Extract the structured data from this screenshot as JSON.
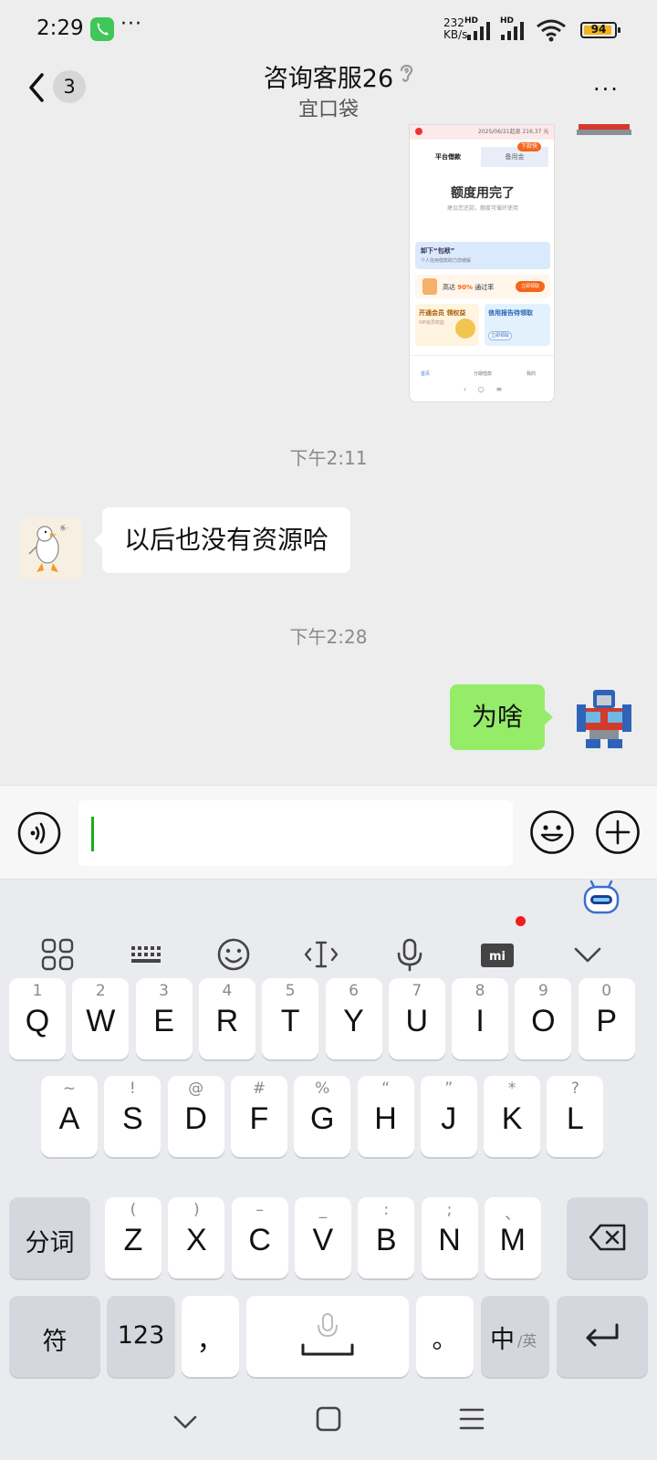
{
  "status_bar": {
    "time": "2:29",
    "dots": "···",
    "net_speed_value": "232",
    "net_speed_unit": "KB/s",
    "hd_label": "HD",
    "battery": "94",
    "icons": [
      "phone-call-icon",
      "signal-icon",
      "wifi-icon",
      "battery-icon"
    ],
    "battery_color": "#f2b31d"
  },
  "header": {
    "unread_badge": "3",
    "title": "咨询客服26",
    "subtitle": "宜口袋",
    "more_label": "···"
  },
  "shared_screenshot": {
    "status": "2025/06/21起息 216.37 元",
    "tab_left": "平台借款",
    "tab_right": "备用金",
    "tab_badge": "下款快",
    "headline": "额度用完了",
    "headline_sub": "建议您还款，额度可循环使用",
    "banner1": "卸下“包袱”",
    "banner1_sub": "个人信用借款助力您缓解",
    "banner2_label": "高达",
    "banner2_pct": "90%",
    "banner2_suffix": "通过率",
    "banner2_btn": "立即领取",
    "card_left": "开通会员 领权益",
    "card_left_sub": "VIP会员权益",
    "card_right": "信用报告待领取",
    "card_right_btn": "立即领取",
    "nav_home": "首页",
    "nav_mid": "分期借款",
    "nav_me": "我的"
  },
  "messages": [
    {
      "type": "timestamp",
      "text": "下午2:11"
    },
    {
      "type": "incoming",
      "text": "以后也没有资源哈",
      "avatar": "goose-avatar"
    },
    {
      "type": "timestamp",
      "text": "下午2:28"
    },
    {
      "type": "outgoing",
      "text": "为啥",
      "avatar": "robot-avatar"
    }
  ],
  "input": {
    "value": "",
    "voice_icon": "voice-icon",
    "emoji_icon": "emoji-icon",
    "plus_icon": "plus-icon"
  },
  "keyboard": {
    "toolbar": [
      "grid-icon",
      "keyboard-icon",
      "emoji-icon",
      "text-cursor-icon",
      "microphone-icon",
      "mi-keyboard-icon",
      "collapse-chevron-icon"
    ],
    "row1": [
      {
        "hint": "1",
        "ch": "Q"
      },
      {
        "hint": "2",
        "ch": "W"
      },
      {
        "hint": "3",
        "ch": "E"
      },
      {
        "hint": "4",
        "ch": "R"
      },
      {
        "hint": "5",
        "ch": "T"
      },
      {
        "hint": "6",
        "ch": "Y"
      },
      {
        "hint": "7",
        "ch": "U"
      },
      {
        "hint": "8",
        "ch": "I"
      },
      {
        "hint": "9",
        "ch": "O"
      },
      {
        "hint": "0",
        "ch": "P"
      }
    ],
    "row2": [
      {
        "hint": "~",
        "ch": "A"
      },
      {
        "hint": "!",
        "ch": "S"
      },
      {
        "hint": "@",
        "ch": "D"
      },
      {
        "hint": "#",
        "ch": "F"
      },
      {
        "hint": "%",
        "ch": "G"
      },
      {
        "hint": "“",
        "ch": "H"
      },
      {
        "hint": "”",
        "ch": "J"
      },
      {
        "hint": "*",
        "ch": "K"
      },
      {
        "hint": "?",
        "ch": "L"
      }
    ],
    "row3": [
      {
        "hint": "(",
        "ch": "Z"
      },
      {
        "hint": ")",
        "ch": "X"
      },
      {
        "hint": "–",
        "ch": "C"
      },
      {
        "hint": "_",
        "ch": "V"
      },
      {
        "hint": ":",
        "ch": "B"
      },
      {
        "hint": ";",
        "ch": "N"
      },
      {
        "hint": "、",
        "ch": "M"
      }
    ],
    "split_key": "分词",
    "symbol_key": "符",
    "num_key": "123",
    "comma_key": "，",
    "period_key": "。",
    "lang_key_main": "中",
    "lang_key_sub": "/英",
    "backspace_icon": "backspace-icon",
    "enter_icon": "enter-icon",
    "space_mic_icon": "microphone-icon"
  },
  "nav_bar": {
    "icons": [
      "back-chevron-icon",
      "home-square-icon",
      "menu-lines-icon"
    ]
  }
}
